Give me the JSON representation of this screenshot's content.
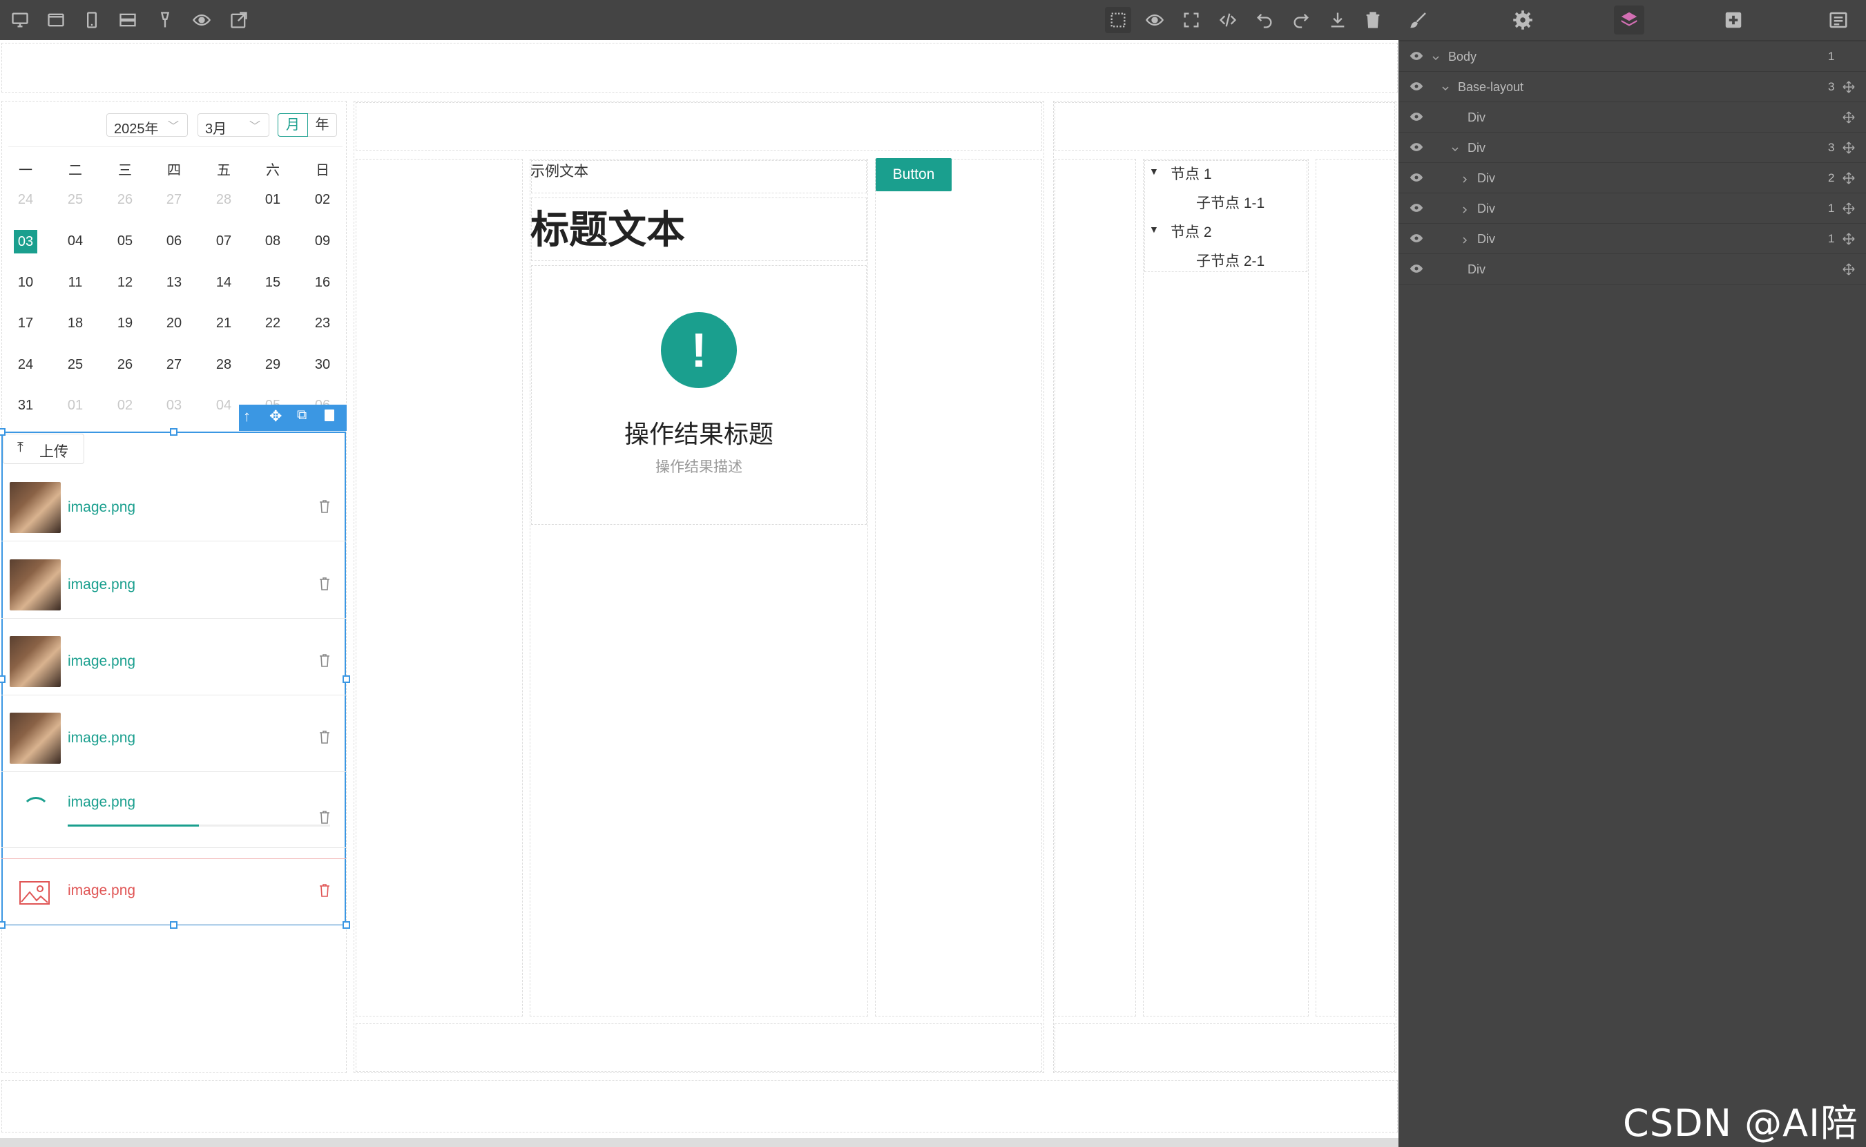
{
  "toolbar": {
    "left_icons": [
      "desktop-icon",
      "tablet-landscape-icon",
      "mobile-icon",
      "rows-icon",
      "brush-tip-icon",
      "preview-icon",
      "open-external-icon"
    ],
    "right_icons": [
      "select-box-icon",
      "preview-icon",
      "fullscreen-icon",
      "code-icon",
      "undo-icon",
      "redo-icon",
      "download-icon",
      "trash-icon"
    ]
  },
  "panel_tabs": [
    "brush-icon",
    "gear-icon",
    "layers-icon",
    "add-block-icon",
    "settings-list-icon"
  ],
  "layers": [
    {
      "label": "Body",
      "count": "1"
    },
    {
      "label": "Base-layout",
      "count": "3"
    },
    {
      "label": "Div",
      "count": ""
    },
    {
      "label": "Div",
      "count": "3"
    },
    {
      "label": "Div",
      "count": "2"
    },
    {
      "label": "Div",
      "count": "1"
    },
    {
      "label": "Div",
      "count": "1"
    },
    {
      "label": "Div",
      "count": ""
    }
  ],
  "calendar": {
    "year": "2025年",
    "month": "3月",
    "mode_month": "月",
    "mode_year": "年",
    "weekdays": [
      "一",
      "二",
      "三",
      "四",
      "五",
      "六",
      "日"
    ],
    "weeks": [
      [
        "24",
        "25",
        "26",
        "27",
        "28",
        "01",
        "02"
      ],
      [
        "03",
        "04",
        "05",
        "06",
        "07",
        "08",
        "09"
      ],
      [
        "10",
        "11",
        "12",
        "13",
        "14",
        "15",
        "16"
      ],
      [
        "17",
        "18",
        "19",
        "20",
        "21",
        "22",
        "23"
      ],
      [
        "24",
        "25",
        "26",
        "27",
        "28",
        "29",
        "30"
      ],
      [
        "31",
        "01",
        "02",
        "03",
        "04",
        "05",
        "06"
      ]
    ]
  },
  "upload": {
    "button": "上传",
    "files": [
      "image.png",
      "image.png",
      "image.png",
      "image.png",
      "image.png",
      "image.png"
    ]
  },
  "content": {
    "sample_text": "示例文本",
    "heading": "标题文本",
    "result_title": "操作结果标题",
    "result_desc": "操作结果描述",
    "button": "Button"
  },
  "tree": {
    "node1": "节点 1",
    "child1": "子节点 1-1",
    "node2": "节点 2",
    "child2": "子节点 2-1"
  },
  "colors": {
    "accent": "#1a9f8e",
    "toolbar": "#444444",
    "selection": "#3b97e3",
    "error": "#e05555"
  },
  "watermark": "CSDN @AI陪跑"
}
